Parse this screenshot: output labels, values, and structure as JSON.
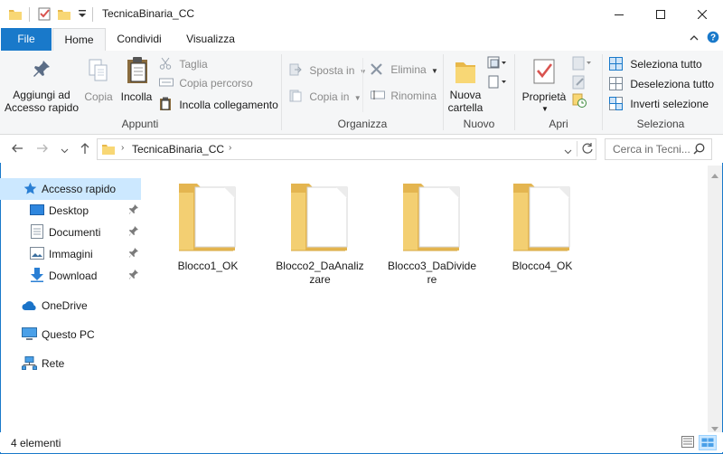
{
  "window": {
    "title": "TecnicaBinaria_CC"
  },
  "title_controls": [
    "minimize",
    "maximize",
    "close"
  ],
  "tabs": [
    {
      "label": "File"
    },
    {
      "label": "Home"
    },
    {
      "label": "Condividi"
    },
    {
      "label": "Visualizza"
    }
  ],
  "ribbon": {
    "appunti": {
      "label": "Appunti",
      "pin_line1": "Aggiungi ad",
      "pin_line2": "Accesso rapido",
      "copy": "Copia",
      "paste": "Incolla",
      "cut": "Taglia",
      "copy_path": "Copia percorso",
      "paste_shortcut": "Incolla collegamento"
    },
    "organizza": {
      "label": "Organizza",
      "move_to": "Sposta in",
      "copy_to": "Copia in",
      "delete": "Elimina",
      "rename": "Rinomina"
    },
    "nuovo": {
      "label": "Nuovo",
      "new_folder_line1": "Nuova",
      "new_folder_line2": "cartella"
    },
    "apri": {
      "label": "Apri",
      "properties": "Proprietà"
    },
    "seleziona": {
      "label": "Seleziona",
      "select_all": "Seleziona tutto",
      "select_none": "Deseleziona tutto",
      "invert": "Inverti selezione"
    }
  },
  "address": {
    "path": "TecnicaBinaria_CC",
    "search_placeholder": "Cerca in Tecni..."
  },
  "nav": {
    "quick_access": "Accesso rapido",
    "items": [
      {
        "label": "Desktop"
      },
      {
        "label": "Documenti"
      },
      {
        "label": "Immagini"
      },
      {
        "label": "Download"
      }
    ],
    "onedrive": "OneDrive",
    "this_pc": "Questo PC",
    "network": "Rete"
  },
  "files": [
    {
      "name": "Blocco1_OK"
    },
    {
      "name": "Blocco2_DaAnalizzare"
    },
    {
      "name": "Blocco3_DaDividere"
    },
    {
      "name": "Blocco4_OK"
    }
  ],
  "status": {
    "count": "4 elementi"
  },
  "colors": {
    "accent": "#1979ca",
    "folder": "#f8d775",
    "selection": "#cce8ff",
    "ribbon_bg": "#f5f6f7"
  }
}
